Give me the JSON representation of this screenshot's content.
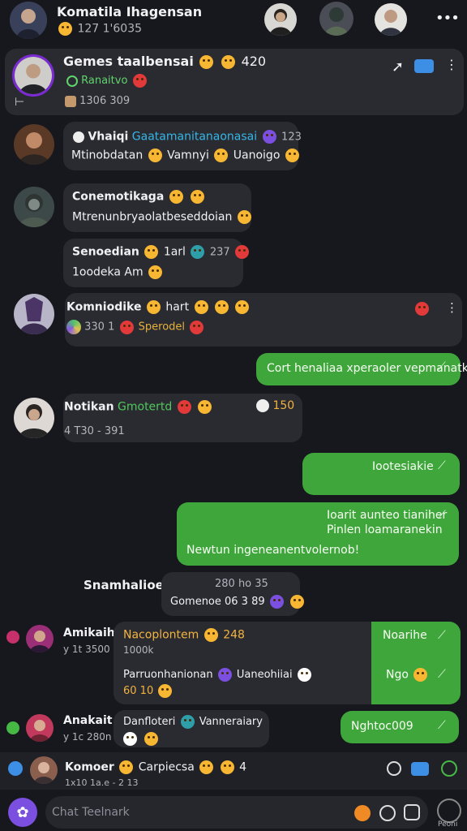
{
  "header": {
    "title": "Komatila Ihagensan",
    "subtitle": "127 1'6035",
    "more_label": "•••"
  },
  "pinned": {
    "title": "Gemes taalbensai",
    "count": "420",
    "status": "Ranaitvo",
    "meta": "1306 309"
  },
  "messages": [
    {
      "name": "Vhaiqi",
      "tag": "Gaatamanitanaonasai",
      "count": "123",
      "text": "Mtinobdatan",
      "text2": "Vamnyi",
      "text3": "Uanoigo"
    },
    {
      "name": "Conemotikaga",
      "text": "Mtrenunbryaolatbeseddoian"
    },
    {
      "name": "Senoedian",
      "extra": "1arl",
      "count": "237",
      "text": "1oodeka Am"
    },
    {
      "name": "Komniodike",
      "extra": "hart",
      "meta": "330 1",
      "tag": "Sperodel"
    }
  ],
  "sent1": {
    "text": "Cort henaliaa xperaoler vepmanatk."
  },
  "item5": {
    "name": "Notikan",
    "tag": "Gmotertd",
    "count": "150",
    "meta": "4 T30 - 391"
  },
  "sent2": {
    "text": "Iootesiakie"
  },
  "sent3": {
    "line1": "Ioarit aunteo tianiher",
    "line2": "Pinlen loamaranekin",
    "line3": "Newtun ingeneanentvolernob!"
  },
  "center": {
    "label": "Snamhalioe",
    "meta": "280 ho",
    "count": "35",
    "text": "Gomenoe 06 3 89"
  },
  "thread1": {
    "name": "Amikaih",
    "meta": "y 1t 3500",
    "title": "Nacoplontem",
    "count": "248",
    "meta2": "1000k",
    "text": "Parruonhanionan",
    "text_b": "Uaneohiiai",
    "meta3": "60 10",
    "side1": "Noarihe",
    "side2": "Ngo"
  },
  "thread2": {
    "name": "Anakait",
    "meta": "y 1c 280n",
    "title": "Danfloteri",
    "title_b": "Vanneraiary",
    "side": "Nghtoc009"
  },
  "footer_preview": {
    "name": "Komoer",
    "tag": "Carpiecsa",
    "count": "4",
    "meta": "1x10 1a.e - 2 13"
  },
  "composer": {
    "placeholder": "Chat Teelnark",
    "side_label": "Peoni"
  },
  "colors": {
    "background": "#17181d",
    "bubble": "#2a2b31",
    "sent": "#3fa63c",
    "accent_purple": "#7b4fe0"
  }
}
